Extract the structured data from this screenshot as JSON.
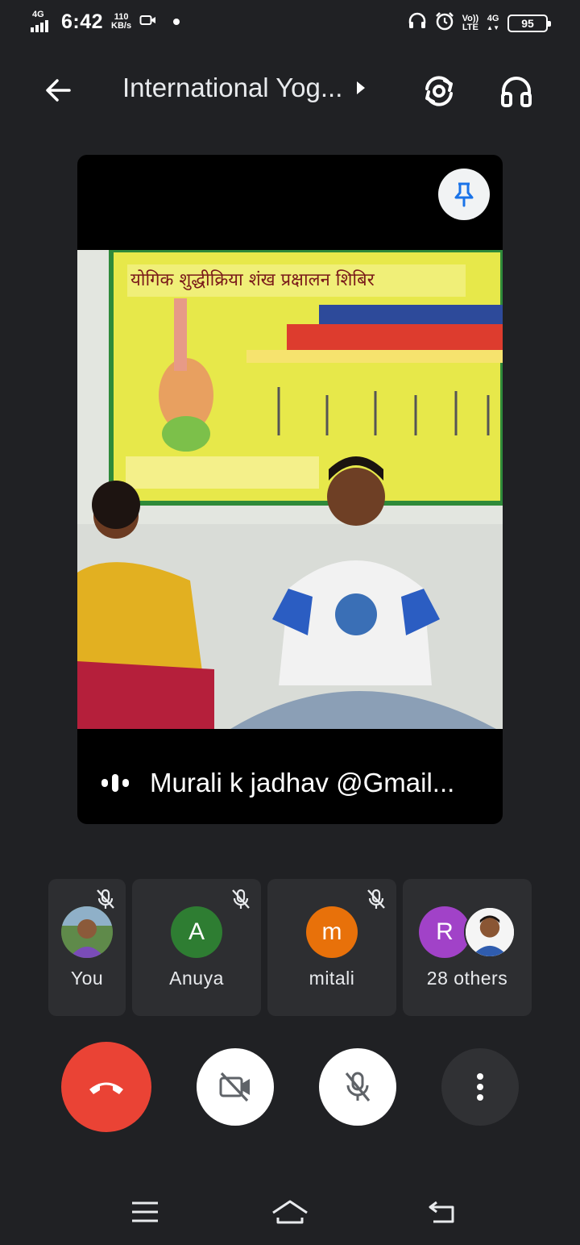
{
  "status_bar": {
    "network_type": "4G",
    "time": "6:42",
    "speed_value": "110",
    "speed_unit": "KB/s",
    "volte_line1": "Vo))",
    "volte_line2": "LTE",
    "network_type_right": "4G",
    "battery": "95"
  },
  "header": {
    "title": "International Yog..."
  },
  "main_video": {
    "speaker_name": "Murali k jadhav @Gmail..."
  },
  "participants": [
    {
      "name": "You",
      "muted": true
    },
    {
      "name": "Anuya",
      "initial": "A",
      "color": "#2e7d32",
      "muted": true
    },
    {
      "name": "mitali",
      "initial": "m",
      "color": "#e8710a",
      "muted": true
    },
    {
      "name": "28 others",
      "initial": "R",
      "color": "#a142c8"
    }
  ],
  "controls": {
    "end_call_color": "#ea4335"
  }
}
